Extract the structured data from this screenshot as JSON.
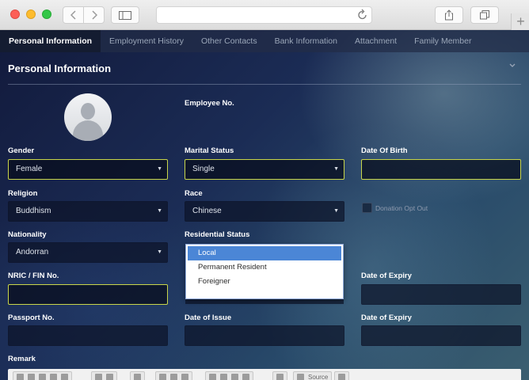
{
  "browser": {
    "reload_icon": "reload-icon",
    "new_tab_label": "+"
  },
  "tabs": [
    {
      "label": "Personal Information",
      "active": true
    },
    {
      "label": "Employment History"
    },
    {
      "label": "Other Contacts"
    },
    {
      "label": "Bank Information"
    },
    {
      "label": "Attachment"
    },
    {
      "label": "Family Member"
    }
  ],
  "section": {
    "title": "Personal Information",
    "collapse_icon": "chevron-down-icon"
  },
  "form": {
    "employee_no_label": "Employee No.",
    "gender": {
      "label": "Gender",
      "value": "Female"
    },
    "marital_status": {
      "label": "Marital Status",
      "value": "Single"
    },
    "date_of_birth": {
      "label": "Date Of Birth",
      "value": ""
    },
    "religion": {
      "label": "Religion",
      "value": "Buddhism"
    },
    "race": {
      "label": "Race",
      "value": "Chinese"
    },
    "donation_opt_out": {
      "label": "Donation Opt Out",
      "checked": false
    },
    "nationality": {
      "label": "Nationality",
      "value": "Andorran"
    },
    "residential_status": {
      "label": "Residential Status",
      "options": [
        "Local",
        "Permanent Resident",
        "Foreigner"
      ],
      "highlighted": "Local"
    },
    "nric": {
      "label": "NRIC / FIN No.",
      "value": ""
    },
    "date_of_expiry_1": {
      "label": "Date of Expiry",
      "value": ""
    },
    "passport_no": {
      "label": "Passport No.",
      "value": ""
    },
    "date_of_issue": {
      "label": "Date of Issue",
      "value": ""
    },
    "date_of_expiry_2": {
      "label": "Date of Expiry",
      "value": ""
    },
    "remark": {
      "label": "Remark",
      "source_button": "Source"
    }
  },
  "colors": {
    "highlight_border": "#c8d54a",
    "dropdown_selected": "#4b86d6",
    "active_tab": "#141c31"
  }
}
